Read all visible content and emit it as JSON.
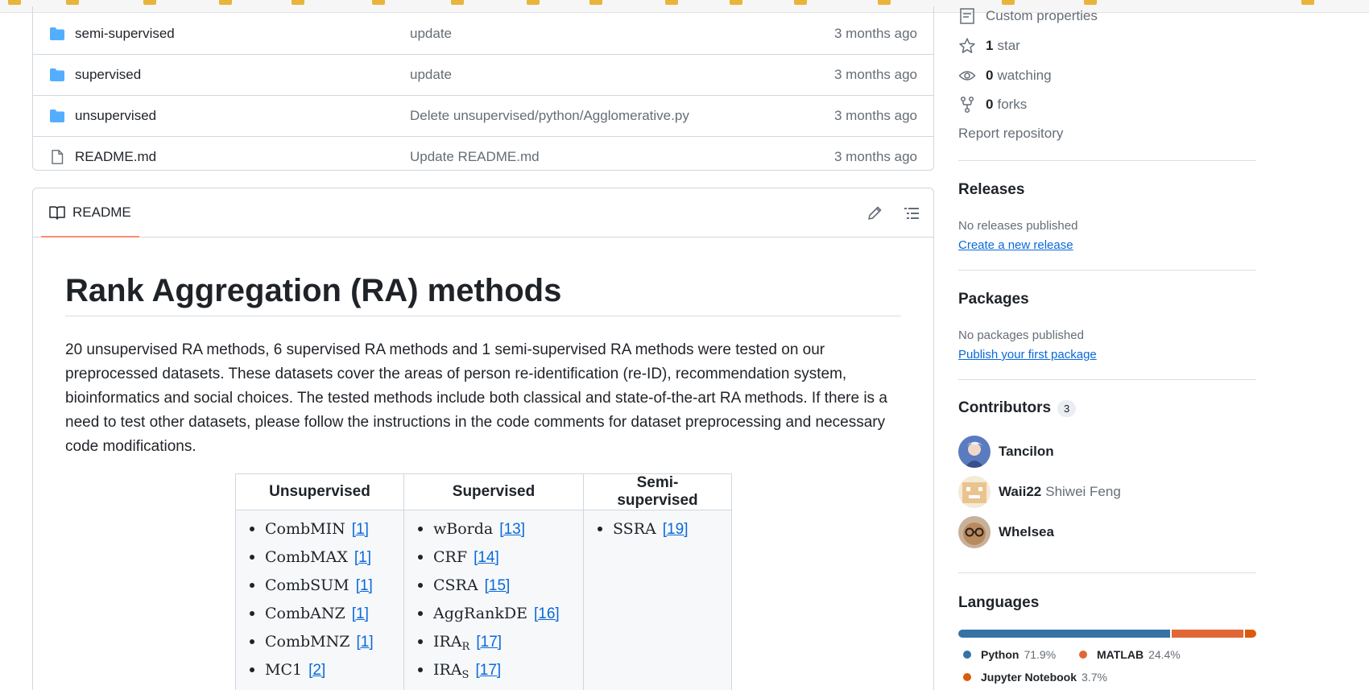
{
  "files": [
    {
      "name": "semi-supervised",
      "type": "folder",
      "message": "update",
      "time": "3 months ago"
    },
    {
      "name": "supervised",
      "type": "folder",
      "message": "update",
      "time": "3 months ago"
    },
    {
      "name": "unsupervised",
      "type": "folder",
      "message": "Delete unsupervised/python/Agglomerative.py",
      "time": "3 months ago"
    },
    {
      "name": "README.md",
      "type": "file",
      "message": "Update README.md",
      "time": "3 months ago"
    }
  ],
  "readme": {
    "tab_label": "README",
    "title": "Rank Aggregation (RA) methods",
    "paragraph": "20 unsupervised RA methods, 6 supervised RA methods and 1 semi-supervised RA methods were tested on our preprocessed datasets. These datasets cover the areas of person re-identification (re-ID), recommendation system, bioinformatics and social choices. The tested methods include both classical and state-of-the-art RA methods. If there is a need to test other datasets, please follow the instructions in the code comments for dataset preprocessing and necessary code modifications.",
    "table": {
      "headers": [
        "Unsupervised",
        "Supervised",
        "Semi-supervised"
      ],
      "unsupervised": [
        {
          "name": "CombMIN",
          "ref": "[1]"
        },
        {
          "name": "CombMAX",
          "ref": "[1]"
        },
        {
          "name": "CombSUM",
          "ref": "[1]"
        },
        {
          "name": "CombANZ",
          "ref": "[1]"
        },
        {
          "name": "CombMNZ",
          "ref": "[1]"
        },
        {
          "name": "MC1",
          "ref": "[2]"
        }
      ],
      "supervised": [
        {
          "name": "wBorda",
          "sub": "",
          "ref": "[13]"
        },
        {
          "name": "CRF",
          "sub": "",
          "ref": "[14]"
        },
        {
          "name": "CSRA",
          "sub": "",
          "ref": "[15]"
        },
        {
          "name": "AggRankDE",
          "sub": "",
          "ref": "[16]"
        },
        {
          "name": "IRA",
          "sub": "R",
          "ref": "[17]"
        },
        {
          "name": "IRA",
          "sub": "S",
          "ref": "[17]"
        }
      ],
      "semi_supervised": [
        {
          "name": "SSRA",
          "ref": "[19]"
        }
      ]
    }
  },
  "sidebar": {
    "custom_properties": "Custom properties",
    "stars_count": "1",
    "stars_label": "star",
    "watching_count": "0",
    "watching_label": "watching",
    "forks_count": "0",
    "forks_label": "forks",
    "report": "Report repository",
    "releases": {
      "title": "Releases",
      "empty": "No releases published",
      "link": "Create a new release"
    },
    "packages": {
      "title": "Packages",
      "empty": "No packages published",
      "link": "Publish your first package"
    },
    "contributors": {
      "title": "Contributors",
      "count": "3",
      "people": [
        {
          "login": "Tancilon",
          "name": ""
        },
        {
          "login": "Waii22",
          "name": "Shiwei Feng"
        },
        {
          "login": "Whelsea",
          "name": ""
        }
      ]
    },
    "languages": {
      "title": "Languages",
      "items": [
        {
          "name": "Python",
          "percent": "71.9%",
          "value": 71.9,
          "color": "#3572A5"
        },
        {
          "name": "MATLAB",
          "percent": "24.4%",
          "value": 24.4,
          "color": "#e16737"
        },
        {
          "name": "Jupyter Notebook",
          "percent": "3.7%",
          "value": 3.7,
          "color": "#DA5B0B"
        }
      ]
    }
  }
}
